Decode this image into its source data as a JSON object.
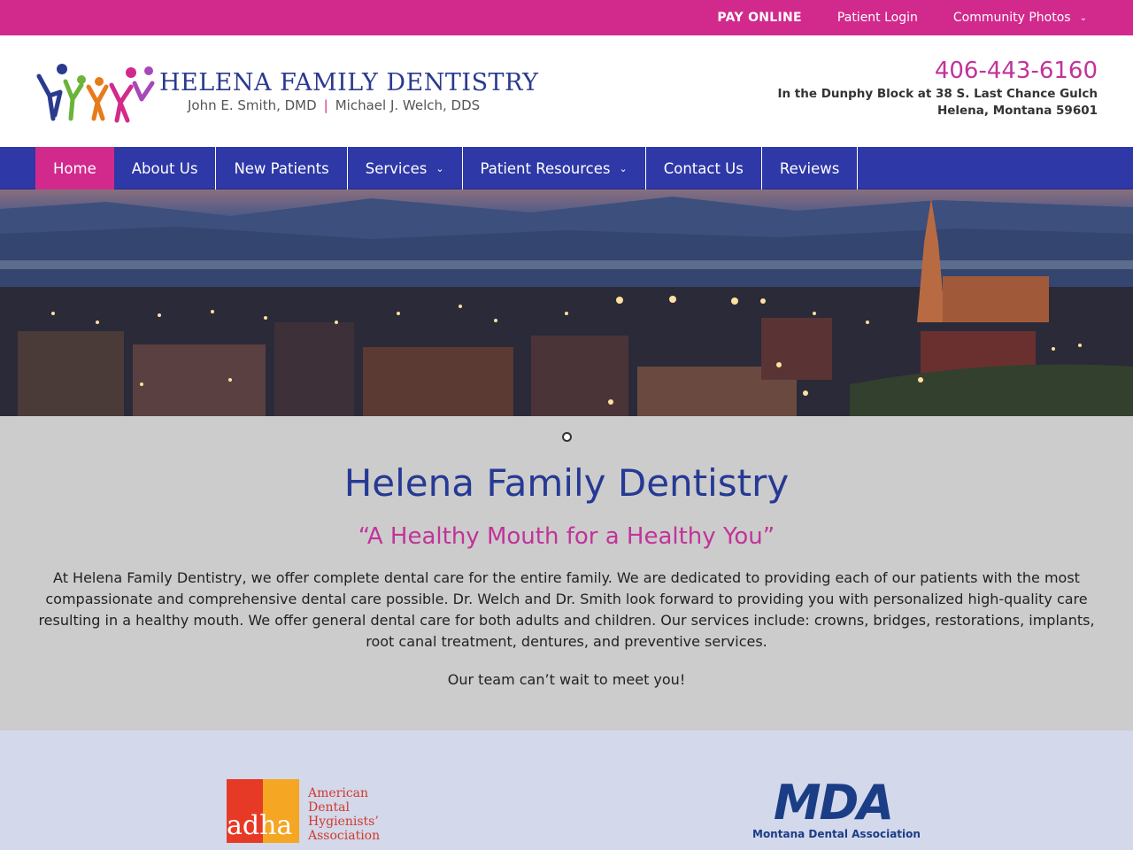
{
  "topbar": {
    "pay_online": "PAY ONLINE",
    "patient_login": "Patient Login",
    "community_photos": "Community Photos"
  },
  "header": {
    "logo_title": "HELENA FAMILY DENTISTRY",
    "logo_doctor1": "John E. Smith, DMD",
    "logo_separator": "|",
    "logo_doctor2": "Michael  J. Welch, DDS",
    "phone": "406-443-6160",
    "address_line1": "In the Dunphy Block at 38 S. Last Chance Gulch",
    "address_line2": "Helena, Montana 59601"
  },
  "nav": {
    "items": [
      {
        "label": "Home",
        "active": true
      },
      {
        "label": "About Us"
      },
      {
        "label": "New Patients"
      },
      {
        "label": "Services",
        "dropdown": true
      },
      {
        "label": "Patient Resources",
        "dropdown": true
      },
      {
        "label": "Contact Us"
      },
      {
        "label": "Reviews"
      }
    ]
  },
  "intro": {
    "title": "Helena Family Dentistry",
    "tagline": "“A Healthy Mouth for a Healthy You”",
    "body": "At Helena Family Dentistry, we offer complete dental care for the entire family. We are dedicated to providing each of our patients with the most compassionate and comprehensive dental care possible. Dr. Welch and Dr. Smith look forward to providing you with personalized high-quality care resulting in a healthy mouth. We offer general dental care for both adults and children. Our services include: crowns, bridges, restorations, implants, root canal treatment, dentures, and preventive services.",
    "closing": "Our team can’t wait to meet you!"
  },
  "affiliations": {
    "adha_mark": "adha",
    "adha_line1": "American",
    "adha_line2": "Dental",
    "adha_line3": "Hygienists’",
    "adha_line4": "Association",
    "mda_mark": "MDA",
    "mda_name": "Montana Dental Association"
  },
  "icons": {
    "chevron": "chevron-down-icon",
    "slider_dot": "slider-dot-icon"
  },
  "colors": {
    "brand_pink": "#d22a8c",
    "nav_blue": "#2e38a6",
    "title_blue": "#263994"
  }
}
